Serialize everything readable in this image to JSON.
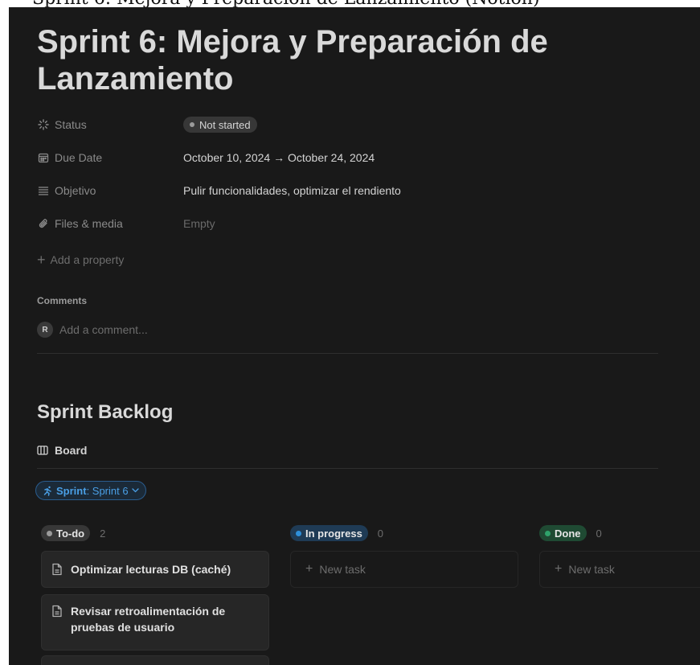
{
  "outer": {
    "title": "Sprint 6: Mejora y Preparación de Lanzamiento (Notion)"
  },
  "page": {
    "title": "Sprint 6: Mejora y Preparación de Lanzamiento"
  },
  "properties": {
    "status": {
      "label": "Status",
      "value": "Not started",
      "icon": "status-spinner-icon"
    },
    "due_date": {
      "label": "Due Date",
      "value": "October 10, 2024 → October 24, 2024",
      "icon": "calendar-icon"
    },
    "objetivo": {
      "label": "Objetivo",
      "value": "Pulir funcionalidades, optimizar el rendiento",
      "icon": "text-lines-icon"
    },
    "files": {
      "label": "Files & media",
      "value": "Empty",
      "icon": "paperclip-icon"
    }
  },
  "add_property": "Add a property",
  "comments": {
    "heading": "Comments",
    "avatar_initial": "R",
    "placeholder": "Add a comment..."
  },
  "backlog": {
    "title": "Sprint Backlog",
    "view_tab": "Board",
    "filter": {
      "label": "Sprint",
      "value": ": Sprint 6"
    },
    "columns": [
      {
        "name": "To-do",
        "count": "2",
        "color": "#9b9b9b",
        "bg": "#373737"
      },
      {
        "name": "In progress",
        "count": "0",
        "color": "#2e8fd9",
        "bg": "#1f3b55"
      },
      {
        "name": "Done",
        "count": "0",
        "color": "#2fa36b",
        "bg": "#1f4a33"
      }
    ],
    "cards": [
      {
        "title": "Optimizar lecturas DB (caché)"
      },
      {
        "title": "Revisar retroalimentación de pruebas de usuario"
      }
    ],
    "new_task": "New task"
  },
  "colors": {
    "background": "#191919",
    "accent": "#2e8fd9"
  }
}
